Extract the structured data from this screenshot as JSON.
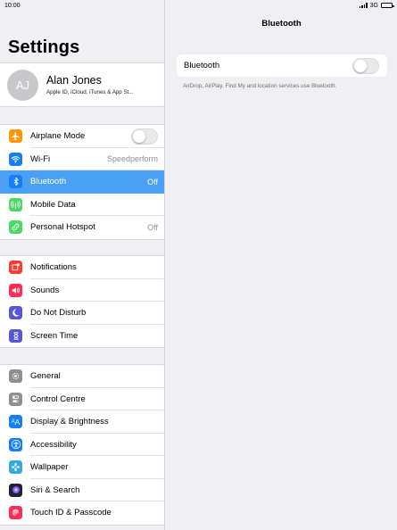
{
  "status_bar": {
    "time": "10:00",
    "network": "3G"
  },
  "master": {
    "title": "Settings",
    "profile": {
      "initials": "AJ",
      "name": "Alan Jones",
      "subtitle": "Apple ID, iCloud, iTunes & App St..."
    },
    "group1": [
      {
        "label": "Airplane Mode",
        "value": "",
        "icon": "airplane-icon",
        "color": "#ff9500",
        "control": "toggle",
        "on": false
      },
      {
        "label": "Wi-Fi",
        "value": "Speedperform",
        "icon": "wifi-icon",
        "color": "#147efb"
      },
      {
        "label": "Bluetooth",
        "value": "Off",
        "icon": "bluetooth-icon",
        "color": "#147efb",
        "selected": true
      },
      {
        "label": "Mobile Data",
        "value": "",
        "icon": "antenna-icon",
        "color": "#4cd964"
      },
      {
        "label": "Personal Hotspot",
        "value": "Off",
        "icon": "hotspot-icon",
        "color": "#4cd964"
      }
    ],
    "group2": [
      {
        "label": "Notifications",
        "icon": "notifications-icon",
        "color": "#ff3b30"
      },
      {
        "label": "Sounds",
        "icon": "speaker-icon",
        "color": "#ff2d55"
      },
      {
        "label": "Do Not Disturb",
        "icon": "moon-icon",
        "color": "#5856d6"
      },
      {
        "label": "Screen Time",
        "icon": "hourglass-icon",
        "color": "#5856d6"
      }
    ],
    "group3": [
      {
        "label": "General",
        "icon": "gear-icon",
        "color": "#8e8e93"
      },
      {
        "label": "Control Centre",
        "icon": "switches-icon",
        "color": "#8e8e93"
      },
      {
        "label": "Display & Brightness",
        "icon": "text-size-icon",
        "color": "#147efb"
      },
      {
        "label": "Accessibility",
        "icon": "accessibility-icon",
        "color": "#147efb"
      },
      {
        "label": "Wallpaper",
        "icon": "flower-icon",
        "color": "#34aadc"
      },
      {
        "label": "Siri & Search",
        "icon": "siri-icon",
        "color": "#222233"
      },
      {
        "label": "Touch ID & Passcode",
        "icon": "fingerprint-icon",
        "color": "#ff2d55"
      }
    ]
  },
  "detail": {
    "title": "Bluetooth",
    "row_label": "Bluetooth",
    "toggle_on": false,
    "footer": "AirDrop, AirPlay, Find My and location services use Bluetooth."
  }
}
